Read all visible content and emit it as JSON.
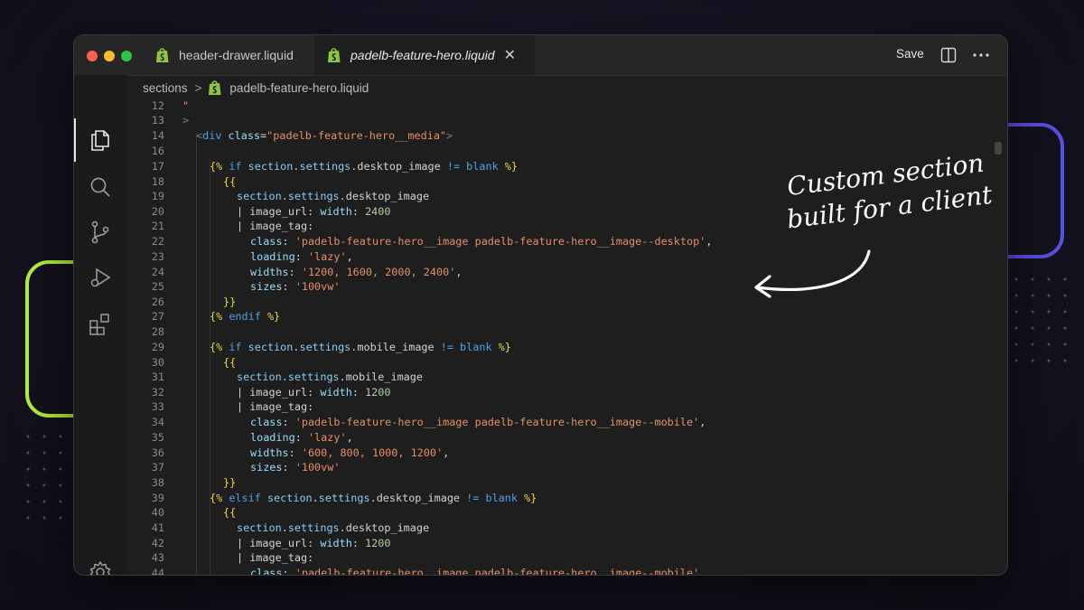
{
  "window": {
    "tabs": [
      {
        "label": "header-drawer.liquid",
        "icon": "shopify-bag-icon",
        "active": false
      },
      {
        "label": "padelb-feature-hero.liquid",
        "icon": "shopify-bag-icon",
        "active": true
      }
    ],
    "close_glyph": "✕",
    "save_label": "Save"
  },
  "activity_bar": [
    "files-icon",
    "search-icon",
    "source-control-icon",
    "run-debug-icon",
    "extensions-icon",
    "settings-gear-icon"
  ],
  "breadcrumb": {
    "folder": "sections",
    "separator": ">",
    "file": "padelb-feature-hero.liquid"
  },
  "colors": {
    "accent_green": "#b4f03a",
    "accent_purple": "#5b4fe6",
    "liquid_delimiter": "#f0d742",
    "string": "#e58f68",
    "keyword": "#4ea1e6"
  },
  "code_lines": [
    {
      "n": "12",
      "tokens": [
        [
          "\"",
          "str"
        ]
      ]
    },
    {
      "n": "13",
      "tokens": [
        [
          ">",
          "tag"
        ]
      ]
    },
    {
      "n": "14",
      "tokens": [
        [
          "<",
          "tag"
        ],
        [
          "div",
          "el"
        ],
        [
          " ",
          "plain"
        ],
        [
          "class",
          "attr"
        ],
        [
          "=",
          "plain"
        ],
        [
          "\"padelb-feature-hero__media\"",
          "str"
        ],
        [
          ">",
          "tag"
        ]
      ]
    },
    {
      "n": "16",
      "tokens": []
    },
    {
      "n": "17",
      "tokens": [
        [
          "{%",
          "lq"
        ],
        [
          " if ",
          "kw"
        ],
        [
          "section",
          "obj"
        ],
        [
          ".",
          "plain"
        ],
        [
          "settings",
          "obj"
        ],
        [
          ".desktop_image ",
          "plain"
        ],
        [
          "!=",
          "kw"
        ],
        [
          " blank ",
          "kw"
        ],
        [
          "%}",
          "lq"
        ]
      ]
    },
    {
      "n": "18",
      "tokens": [
        [
          "{{",
          "lq"
        ]
      ]
    },
    {
      "n": "19",
      "tokens": [
        [
          "section",
          "obj"
        ],
        [
          ".",
          "plain"
        ],
        [
          "settings",
          "obj"
        ],
        [
          ".desktop_image",
          "plain"
        ]
      ]
    },
    {
      "n": "20",
      "tokens": [
        [
          "| image_url: ",
          "plain"
        ],
        [
          "width",
          "attr"
        ],
        [
          ": ",
          "plain"
        ],
        [
          "2400",
          "num"
        ]
      ]
    },
    {
      "n": "21",
      "tokens": [
        [
          "| image_tag:",
          "plain"
        ]
      ]
    },
    {
      "n": "22",
      "tokens": [
        [
          "class",
          "attr"
        ],
        [
          ": ",
          "plain"
        ],
        [
          "'padelb-feature-hero__image padelb-feature-hero__image--desktop'",
          "str"
        ],
        [
          ",",
          "plain"
        ]
      ]
    },
    {
      "n": "23",
      "tokens": [
        [
          "loading",
          "attr"
        ],
        [
          ": ",
          "plain"
        ],
        [
          "'lazy'",
          "str"
        ],
        [
          ",",
          "plain"
        ]
      ]
    },
    {
      "n": "24",
      "tokens": [
        [
          "widths",
          "attr"
        ],
        [
          ": ",
          "plain"
        ],
        [
          "'1200, 1600, 2000, 2400'",
          "str"
        ],
        [
          ",",
          "plain"
        ]
      ]
    },
    {
      "n": "25",
      "tokens": [
        [
          "sizes",
          "attr"
        ],
        [
          ": ",
          "plain"
        ],
        [
          "'100vw'",
          "str"
        ]
      ]
    },
    {
      "n": "26",
      "tokens": [
        [
          "}}",
          "lq"
        ]
      ]
    },
    {
      "n": "27",
      "tokens": [
        [
          "{%",
          "lq"
        ],
        [
          " endif ",
          "kw"
        ],
        [
          "%}",
          "lq"
        ]
      ]
    },
    {
      "n": "28",
      "tokens": []
    },
    {
      "n": "29",
      "tokens": [
        [
          "{%",
          "lq"
        ],
        [
          " if ",
          "kw"
        ],
        [
          "section",
          "obj"
        ],
        [
          ".",
          "plain"
        ],
        [
          "settings",
          "obj"
        ],
        [
          ".mobile_image ",
          "plain"
        ],
        [
          "!=",
          "kw"
        ],
        [
          " blank ",
          "kw"
        ],
        [
          "%}",
          "lq"
        ]
      ]
    },
    {
      "n": "30",
      "tokens": [
        [
          "{{",
          "lq"
        ]
      ]
    },
    {
      "n": "31",
      "tokens": [
        [
          "section",
          "obj"
        ],
        [
          ".",
          "plain"
        ],
        [
          "settings",
          "obj"
        ],
        [
          ".mobile_image",
          "plain"
        ]
      ]
    },
    {
      "n": "32",
      "tokens": [
        [
          "| image_url: ",
          "plain"
        ],
        [
          "width",
          "attr"
        ],
        [
          ": ",
          "plain"
        ],
        [
          "1200",
          "num"
        ]
      ]
    },
    {
      "n": "33",
      "tokens": [
        [
          "| image_tag:",
          "plain"
        ]
      ]
    },
    {
      "n": "34",
      "tokens": [
        [
          "class",
          "attr"
        ],
        [
          ": ",
          "plain"
        ],
        [
          "'padelb-feature-hero__image padelb-feature-hero__image--mobile'",
          "str"
        ],
        [
          ",",
          "plain"
        ]
      ]
    },
    {
      "n": "35",
      "tokens": [
        [
          "loading",
          "attr"
        ],
        [
          ": ",
          "plain"
        ],
        [
          "'lazy'",
          "str"
        ],
        [
          ",",
          "plain"
        ]
      ]
    },
    {
      "n": "36",
      "tokens": [
        [
          "widths",
          "attr"
        ],
        [
          ": ",
          "plain"
        ],
        [
          "'600, 800, 1000, 1200'",
          "str"
        ],
        [
          ",",
          "plain"
        ]
      ]
    },
    {
      "n": "37",
      "tokens": [
        [
          "sizes",
          "attr"
        ],
        [
          ": ",
          "plain"
        ],
        [
          "'100vw'",
          "str"
        ]
      ]
    },
    {
      "n": "38",
      "tokens": [
        [
          "}}",
          "lq"
        ]
      ]
    },
    {
      "n": "39",
      "tokens": [
        [
          "{%",
          "lq"
        ],
        [
          " elsif ",
          "kw"
        ],
        [
          "section",
          "obj"
        ],
        [
          ".",
          "plain"
        ],
        [
          "settings",
          "obj"
        ],
        [
          ".desktop_image ",
          "plain"
        ],
        [
          "!=",
          "kw"
        ],
        [
          " blank ",
          "kw"
        ],
        [
          "%}",
          "lq"
        ]
      ]
    },
    {
      "n": "40",
      "tokens": [
        [
          "{{",
          "lq"
        ]
      ]
    },
    {
      "n": "41",
      "tokens": [
        [
          "section",
          "obj"
        ],
        [
          ".",
          "plain"
        ],
        [
          "settings",
          "obj"
        ],
        [
          ".desktop_image",
          "plain"
        ]
      ]
    },
    {
      "n": "42",
      "tokens": [
        [
          "| image_url: ",
          "plain"
        ],
        [
          "width",
          "attr"
        ],
        [
          ": ",
          "plain"
        ],
        [
          "1200",
          "num"
        ]
      ]
    },
    {
      "n": "43",
      "tokens": [
        [
          "| image_tag:",
          "plain"
        ]
      ]
    },
    {
      "n": "44",
      "tokens": [
        [
          "class",
          "attr"
        ],
        [
          ": ",
          "plain"
        ],
        [
          "'padelb-feature-hero__image padelb-feature-hero__image--mobile'",
          "str"
        ],
        [
          ",",
          "plain"
        ]
      ]
    }
  ],
  "annotation": {
    "line1": "Custom section",
    "line2": "built for a client"
  }
}
